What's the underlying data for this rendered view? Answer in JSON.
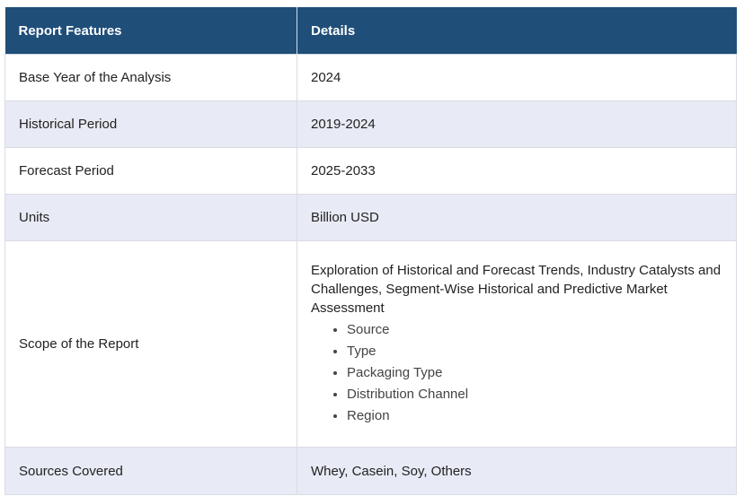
{
  "table": {
    "headers": [
      "Report Features",
      "Details"
    ],
    "rows": [
      {
        "feature": "Base Year of the Analysis",
        "detail": "2024"
      },
      {
        "feature": "Historical Period",
        "detail": "2019-2024"
      },
      {
        "feature": "Forecast Period",
        "detail": "2025-2033"
      },
      {
        "feature": "Units",
        "detail": "Billion USD"
      },
      {
        "feature": "Scope of the Report",
        "detail": "Exploration of Historical and Forecast Trends, Industry Catalysts and Challenges, Segment-Wise Historical and Predictive Market Assessment",
        "bullets": [
          "Source",
          "Type",
          "Packaging Type",
          "Distribution Channel",
          "Region"
        ]
      },
      {
        "feature": "Sources Covered",
        "detail": "Whey, Casein, Soy, Others"
      }
    ]
  },
  "colors": {
    "header_bg": "#1f4e79",
    "header_text": "#ffffff",
    "alt_row_bg": "#e8ebf5",
    "border": "#d9dce3"
  }
}
